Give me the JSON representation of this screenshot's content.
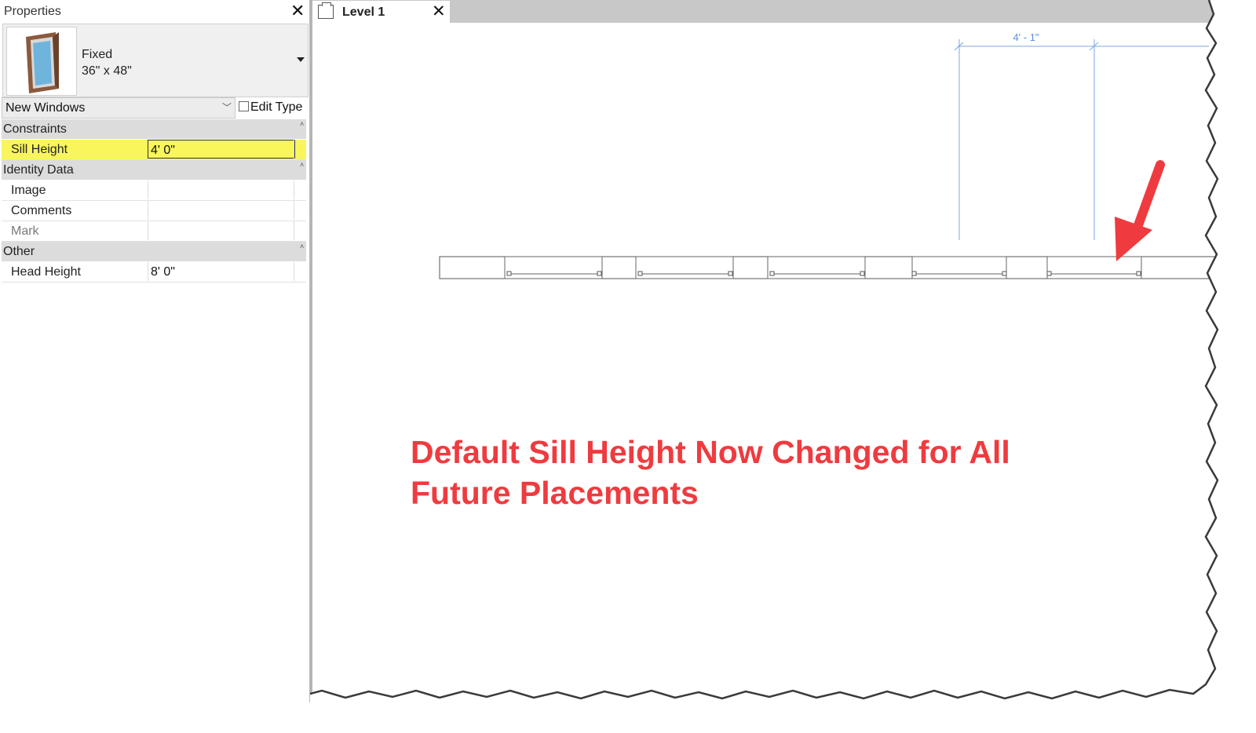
{
  "properties": {
    "title": "Properties",
    "close_icon": "close-icon",
    "type_selector": {
      "thumbnail_icon": "window-thumbnail-icon",
      "family": "Fixed",
      "type": "36\" x 48\""
    },
    "filter": {
      "value": "New Windows"
    },
    "edit_type_label": "Edit Type",
    "groups": [
      {
        "label": "Constraints",
        "rows": [
          {
            "label": "Sill Height",
            "value": "4'  0\"",
            "highlighted": true
          }
        ]
      },
      {
        "label": "Identity Data",
        "rows": [
          {
            "label": "Image",
            "value": ""
          },
          {
            "label": "Comments",
            "value": ""
          },
          {
            "label": "Mark",
            "value": ""
          }
        ]
      },
      {
        "label": "Other",
        "rows": [
          {
            "label": "Head Height",
            "value": "8'  0\""
          }
        ]
      }
    ]
  },
  "view_tab": {
    "label": "Level 1",
    "icon": "floor-plan-view-icon",
    "close_icon": "close-icon"
  },
  "canvas": {
    "dimension_text": "4' - 1\""
  },
  "annotation": {
    "line1": "Default Sill Height Now Changed for All",
    "line2": "Future Placements",
    "color": "#ef3b3f",
    "arrow_icon": "red-arrow-icon"
  },
  "colors": {
    "highlight": "#f8f65a",
    "dimension": "#5b8fd9",
    "tab_bar": "#c8c8c8"
  }
}
